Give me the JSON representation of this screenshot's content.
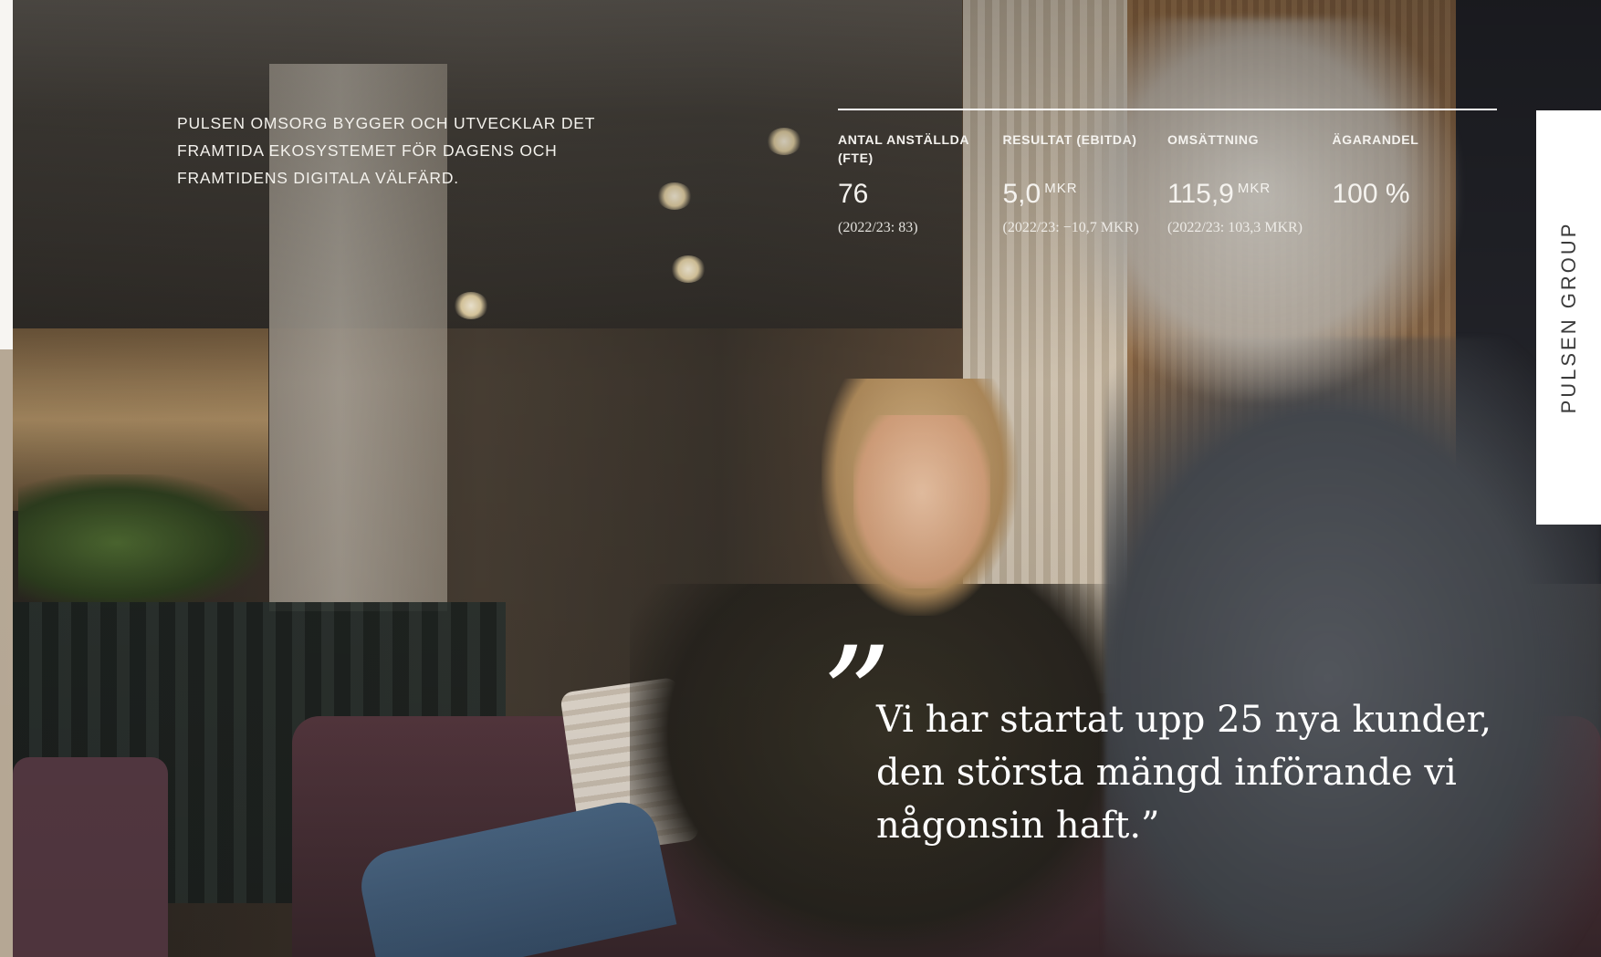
{
  "intro_text": "PULSEN OMSORG BYGGER OCH UTVECKLAR DET FRAMTIDA EKOSYSTEMET FÖR DAGENS OCH FRAMTIDENS DIGITALA VÄLFÄRD.",
  "stats": [
    {
      "label": "ANTAL ANSTÄLLDA (FTE)",
      "value": "76",
      "unit": "",
      "previous": "(2022/23: 83)"
    },
    {
      "label": "RESULTAT (EBITDA)",
      "value": "5,0",
      "unit": "MKR",
      "previous": "(2022/23: −10,7 MKR)"
    },
    {
      "label": "OMSÄTTNING",
      "value": "115,9",
      "unit": "MKR",
      "previous": "(2022/23: 103,3  MKR)"
    },
    {
      "label": "ÄGARANDEL",
      "value": "100 %",
      "unit": "",
      "previous": ""
    }
  ],
  "side_tab": {
    "label": "PULSEN GROUP"
  },
  "quote": {
    "mark": "”",
    "text": "Vi har startat upp 25 nya kunder, den största mängd införande vi någonsin haft.”"
  },
  "colors": {
    "text_light": "#ffffff",
    "tab_bg": "#ffffff",
    "tab_text": "#3b3b3b"
  }
}
